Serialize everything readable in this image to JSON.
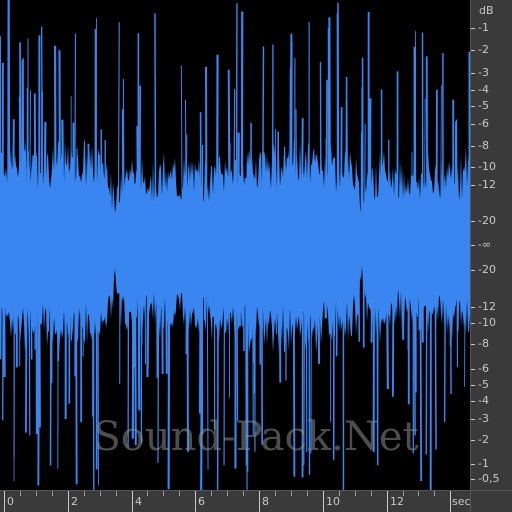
{
  "colors": {
    "waveform": "#3a86f0",
    "background": "#000000",
    "ruler": "#3a3a3a",
    "ruler_text": "#c8c8c8"
  },
  "db_ruler": {
    "unit": "dB",
    "labels": [
      "-1",
      "-2",
      "-3",
      "-4",
      "-5",
      "-6",
      "-8",
      "-10",
      "-12",
      "-20",
      "-∞",
      "-20",
      "-12",
      "-10",
      "-8",
      "-6",
      "-5",
      "-4",
      "-3",
      "-2",
      "-1",
      "-0,5"
    ]
  },
  "time_ruler": {
    "unit": "sec",
    "labels": [
      "0",
      "2",
      "4",
      "6",
      "8",
      "10",
      "12"
    ],
    "max_seconds": 14.3
  },
  "watermark": "Sound-Pack.Net",
  "waveform": {
    "seconds_visible": 14.3,
    "beat_gaps_seconds": [
      3.5,
      11.0
    ]
  }
}
